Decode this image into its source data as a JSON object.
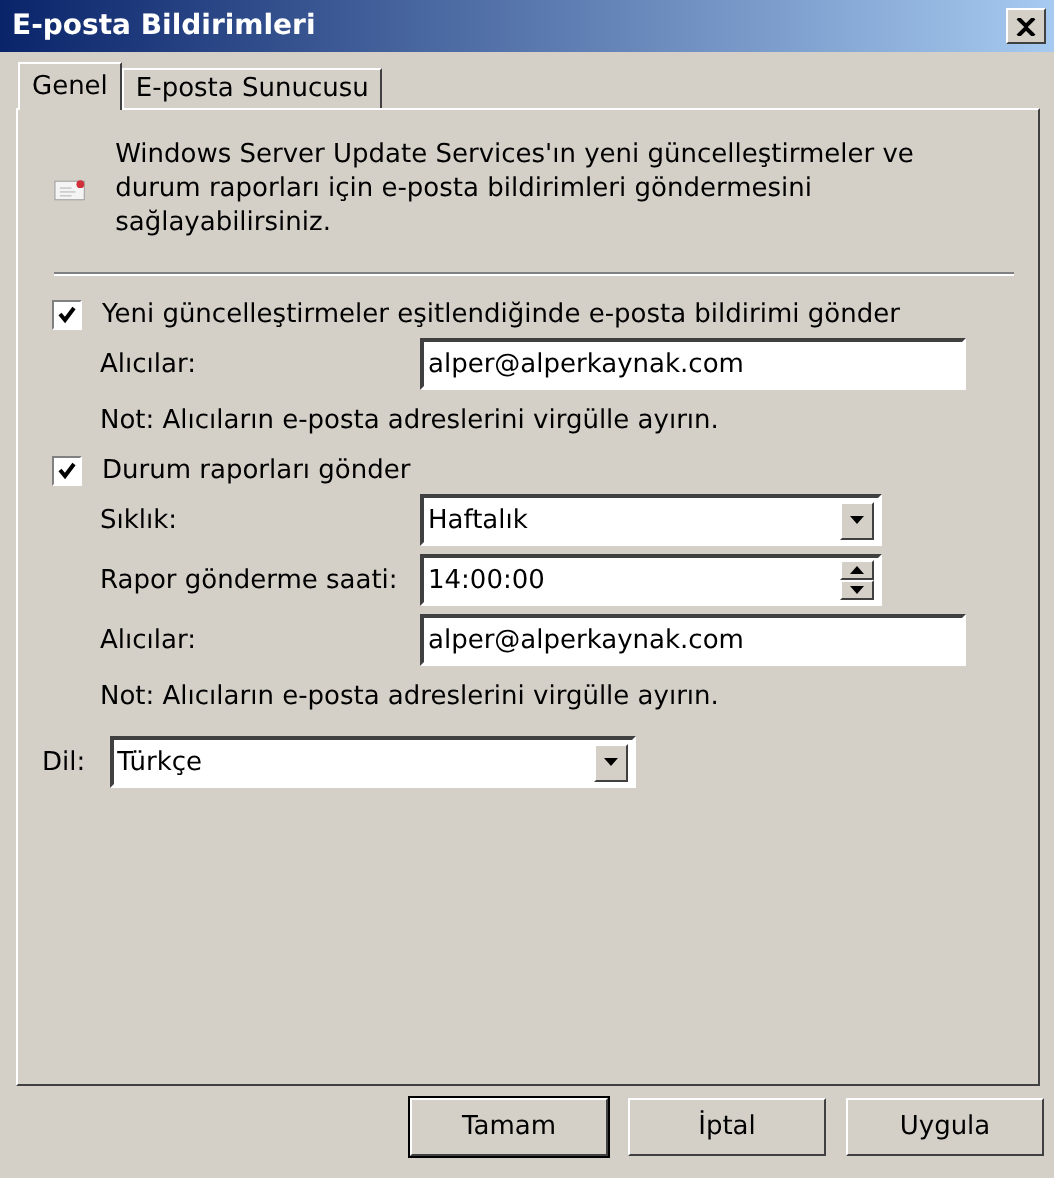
{
  "window": {
    "title": "E-posta Bildirimleri"
  },
  "tabs": [
    {
      "label": "Genel",
      "selected": true
    },
    {
      "label": "E-posta Sunucusu",
      "selected": false
    }
  ],
  "description": "Windows Server Update Services'ın yeni güncelleştirmeler ve durum raporları için e-posta bildirimleri göndermesini sağlayabilirsiniz.",
  "sections": [
    {
      "checkbox": {
        "label": "Yeni güncelleştirmeler eşitlendiğinde e-posta bildirimi gönder",
        "checked": true
      },
      "fields": [
        {
          "kind": "text",
          "label": "Alıcılar:",
          "value": "alper@alperkaynak.com"
        }
      ],
      "note": "Not: Alıcıların e-posta adreslerini virgülle ayırın."
    },
    {
      "checkbox": {
        "label": "Durum raporları gönder",
        "checked": true
      },
      "fields": [
        {
          "kind": "dropdown",
          "label": "Sıklık:",
          "value": "Haftalık"
        },
        {
          "kind": "spinner",
          "label": "Rapor gönderme saati:",
          "value": "14:00:00"
        },
        {
          "kind": "text",
          "label": "Alıcılar:",
          "value": "alper@alperkaynak.com"
        }
      ],
      "note": "Not: Alıcıların e-posta adreslerini virgülle ayırın."
    }
  ],
  "language": {
    "label": "Dil:",
    "value": "Türkçe"
  },
  "buttons": [
    "Tamam",
    "İptal",
    "Uygula"
  ]
}
